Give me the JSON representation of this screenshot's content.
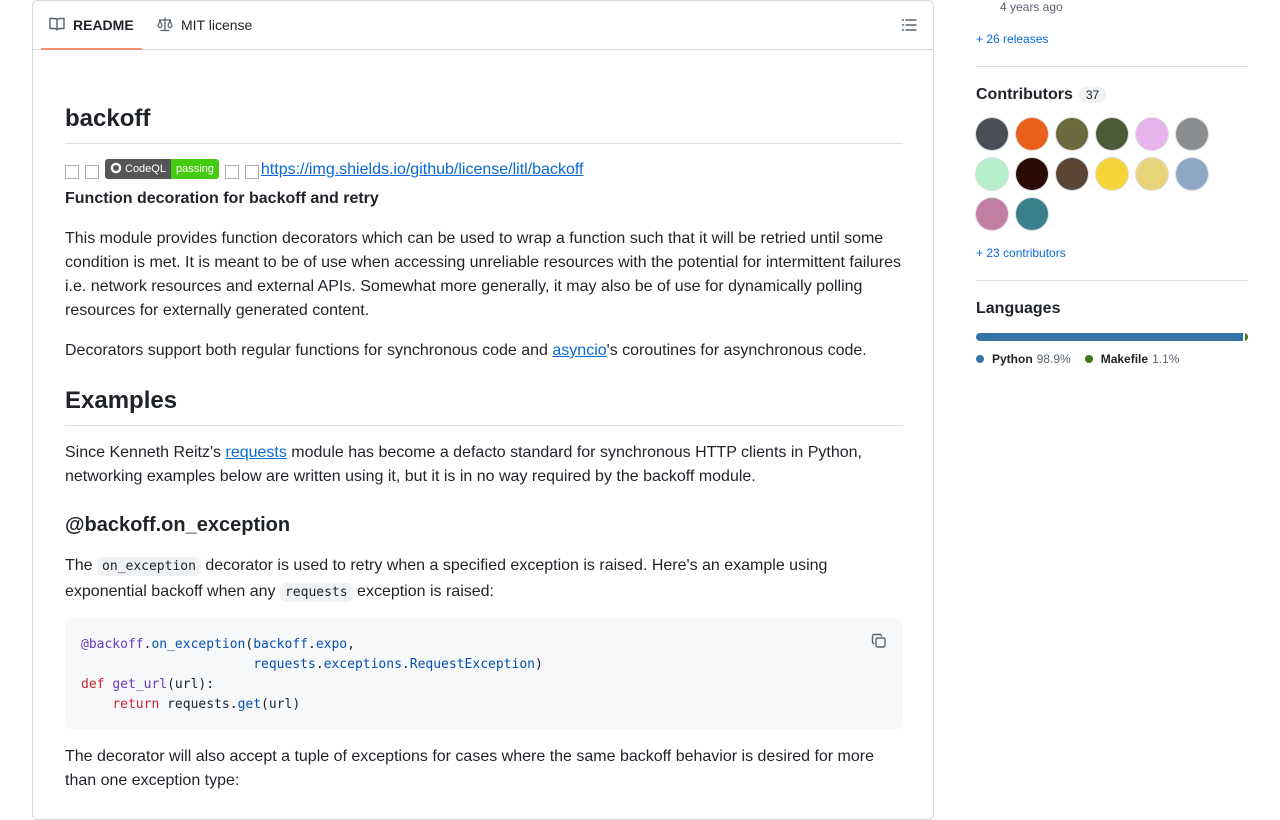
{
  "tabs": {
    "readme": "README",
    "license": "MIT license"
  },
  "readme": {
    "title": "backoff",
    "badge_codeql_left": "CodeQL",
    "badge_codeql_right": "passing",
    "license_badge_alt": "https://img.shields.io/github/license/litl/backoff",
    "subtitle": "Function decoration for backoff and retry",
    "intro": "This module provides function decorators which can be used to wrap a function such that it will be retried until some condition is met. It is meant to be of use when accessing unreliable resources with the potential for intermittent failures i.e. network resources and external APIs. Somewhat more generally, it may also be of use for dynamically polling resources for externally generated content.",
    "decorators_pre": "Decorators support both regular functions for synchronous code and ",
    "decorators_link": "asyncio",
    "decorators_post": "'s coroutines for asynchronous code.",
    "examples_heading": "Examples",
    "examples_pre": "Since Kenneth Reitz's ",
    "examples_link": "requests",
    "examples_post": " module has become a defacto standard for synchronous HTTP clients in Python, networking examples below are written using it, but it is in no way required by the backoff module.",
    "on_exception_heading": "@backoff.on_exception",
    "on_exc_p1": "The ",
    "on_exc_code1": "on_exception",
    "on_exc_p2": " decorator is used to retry when a specified exception is raised. Here's an example using exponential backoff when any ",
    "on_exc_code2": "requests",
    "on_exc_p3": " exception is raised:",
    "tuple_text": "The decorator will also accept a tuple of exceptions for cases where the same backoff behavior is desired for more than one exception type:"
  },
  "code": {
    "l1a": "@backoff",
    "l1b": ".",
    "l1c": "on_exception",
    "l1d": "(",
    "l1e": "backoff",
    "l1f": ".",
    "l1g": "expo",
    "l1h": ",",
    "l2a": "requests",
    "l2b": ".",
    "l2c": "exceptions",
    "l2d": ".",
    "l2e": "RequestException",
    "l2f": ")",
    "l3a": "def",
    "l3b": "get_url",
    "l3c": "(url):",
    "l4a": "return",
    "l4b": " requests",
    "l4c": ".",
    "l4d": "get",
    "l4e": "(url)"
  },
  "sidebar": {
    "release_ago": "4 years ago",
    "releases_link": "+ 26 releases",
    "contributors_title": "Contributors",
    "contributors_count": "37",
    "more_contributors": "+ 23 contributors",
    "languages_title": "Languages",
    "languages": [
      {
        "name": "Python",
        "percent": "98.9%",
        "value": 98.9,
        "color": "#3572A5"
      },
      {
        "name": "Makefile",
        "percent": "1.1%",
        "value": 1.1,
        "color": "#427819"
      }
    ],
    "avatar_colors": [
      "#4a4f57",
      "#e8601c",
      "#6b6a3f",
      "#4d5a3a",
      "#e7b3ec",
      "#8a8d90",
      "#b6efc9",
      "#2a0a05",
      "#5b4636",
      "#f5d43a",
      "#e8d27a",
      "#8fa7c4",
      "#c27fa6",
      "#3a7f8c"
    ]
  }
}
